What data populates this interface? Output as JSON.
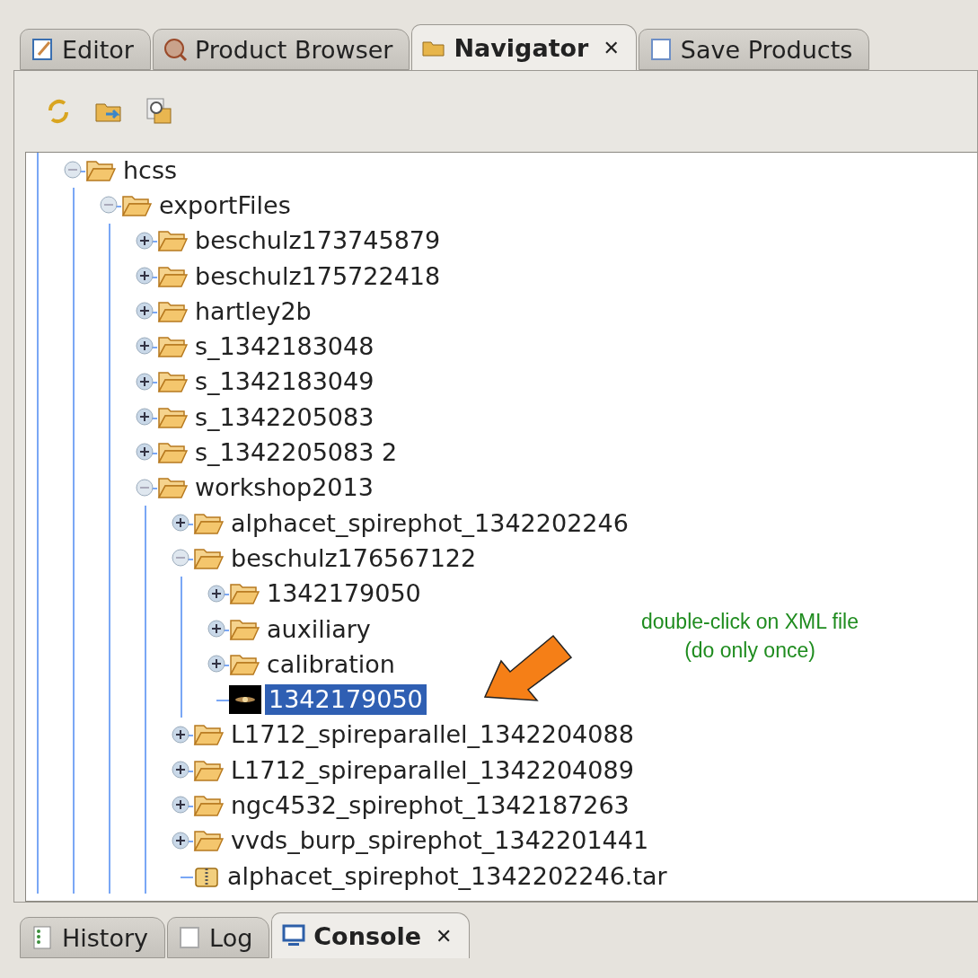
{
  "top_tabs": [
    {
      "label": "Editor",
      "selected": false,
      "closable": false
    },
    {
      "label": "Product Browser",
      "selected": false,
      "closable": false
    },
    {
      "label": "Navigator",
      "selected": true,
      "closable": true,
      "close_glyph": "✕"
    },
    {
      "label": "Save Products",
      "selected": false,
      "closable": false
    }
  ],
  "tree": [
    {
      "label": "hcss",
      "kind": "folder",
      "expanded": true,
      "selected": false,
      "children": [
        {
          "label": "exportFiles",
          "kind": "folder",
          "expanded": true,
          "selected": false,
          "children": [
            {
              "label": "beschulz173745879",
              "kind": "folder",
              "expanded": false,
              "selected": false
            },
            {
              "label": "beschulz175722418",
              "kind": "folder",
              "expanded": false,
              "selected": false
            },
            {
              "label": "hartley2b",
              "kind": "folder",
              "expanded": false,
              "selected": false
            },
            {
              "label": "s_1342183048",
              "kind": "folder",
              "expanded": false,
              "selected": false
            },
            {
              "label": "s_1342183049",
              "kind": "folder",
              "expanded": false,
              "selected": false
            },
            {
              "label": "s_1342205083",
              "kind": "folder",
              "expanded": false,
              "selected": false
            },
            {
              "label": "s_1342205083 2",
              "kind": "folder",
              "expanded": false,
              "selected": false
            },
            {
              "label": "workshop2013",
              "kind": "folder",
              "expanded": true,
              "selected": false,
              "children": [
                {
                  "label": "alphacet_spirephot_1342202246",
                  "kind": "folder",
                  "expanded": false,
                  "selected": false
                },
                {
                  "label": "beschulz176567122",
                  "kind": "folder",
                  "expanded": true,
                  "selected": false,
                  "children": [
                    {
                      "label": "1342179050",
                      "kind": "folder",
                      "expanded": false,
                      "selected": false
                    },
                    {
                      "label": "auxiliary",
                      "kind": "folder",
                      "expanded": false,
                      "selected": false
                    },
                    {
                      "label": "calibration",
                      "kind": "folder",
                      "expanded": false,
                      "selected": false
                    },
                    {
                      "label": "1342179050",
                      "kind": "image",
                      "selected": true
                    }
                  ]
                },
                {
                  "label": "L1712_spireparallel_1342204088",
                  "kind": "folder",
                  "expanded": false,
                  "selected": false
                },
                {
                  "label": "L1712_spireparallel_1342204089",
                  "kind": "folder",
                  "expanded": false,
                  "selected": false
                },
                {
                  "label": "ngc4532_spirephot_1342187263",
                  "kind": "folder",
                  "expanded": false,
                  "selected": false
                },
                {
                  "label": "vvds_burp_spirephot_1342201441",
                  "kind": "folder",
                  "expanded": false,
                  "selected": false
                },
                {
                  "label": "alphacet_spirephot_1342202246.tar",
                  "kind": "archive",
                  "selected": false
                }
              ]
            }
          ]
        }
      ]
    }
  ],
  "annotation": {
    "lines": [
      "double-click on XML file",
      "(do only once)"
    ]
  },
  "bottom_tabs": [
    {
      "label": "History",
      "selected": false,
      "closable": false
    },
    {
      "label": "Log",
      "selected": false,
      "closable": false
    },
    {
      "label": "Console",
      "selected": true,
      "closable": true,
      "close_glyph": "✕"
    }
  ]
}
